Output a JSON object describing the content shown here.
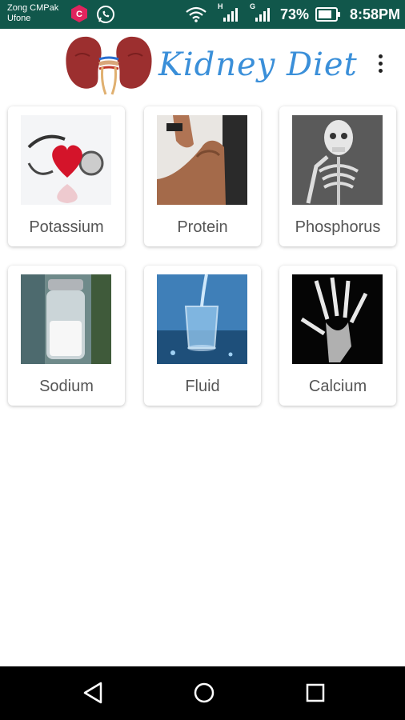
{
  "status_bar": {
    "carrier_line1": "Zong CMPak",
    "carrier_line2": "Ufone",
    "battery_percent": "73%",
    "time": "8:58PM",
    "network_1": "H",
    "network_2": "G",
    "icons": [
      "c-app-icon",
      "whatsapp-icon",
      "wifi-icon",
      "signal-icon",
      "signal-icon",
      "battery-icon"
    ]
  },
  "app_bar": {
    "title": "Kidney Diet",
    "logo_icon": "kidney-logo",
    "menu_icon": "overflow-menu-icon"
  },
  "categories": [
    {
      "label": "Potassium",
      "icon": "heart-stethoscope-image"
    },
    {
      "label": "Protein",
      "icon": "flexed-arm-image"
    },
    {
      "label": "Phosphorus",
      "icon": "skeleton-image"
    },
    {
      "label": "Sodium",
      "icon": "salt-shaker-image"
    },
    {
      "label": "Fluid",
      "icon": "water-glass-image"
    },
    {
      "label": "Calcium",
      "icon": "hand-xray-image"
    }
  ],
  "nav_bar": {
    "icons": [
      "back-icon",
      "home-icon",
      "recents-icon"
    ]
  }
}
